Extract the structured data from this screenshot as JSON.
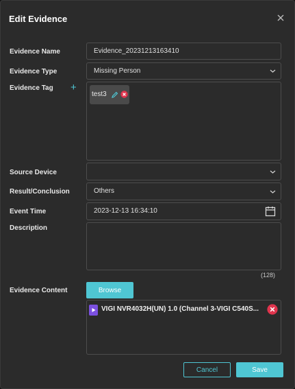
{
  "dialog": {
    "title": "Edit Evidence"
  },
  "fields": {
    "name": {
      "label": "Evidence Name",
      "value": "Evidence_20231213163410"
    },
    "type": {
      "label": "Evidence Type",
      "value": "Missing Person"
    },
    "tag": {
      "label": "Evidence Tag",
      "add_symbol": "+",
      "tags": [
        "test3"
      ]
    },
    "source": {
      "label": "Source Device",
      "value": ""
    },
    "result": {
      "label": "Result/Conclusion",
      "value": "Others"
    },
    "time": {
      "label": "Event Time",
      "value": "2023-12-13 16:34:10"
    },
    "description": {
      "label": "Description",
      "value": "",
      "counter": "(128)"
    },
    "content": {
      "label": "Evidence Content",
      "browse_label": "Browse",
      "files": [
        "VIGI NVR4032H(UN) 1.0 (Channel 3-VIGI C540S..."
      ]
    }
  },
  "footer": {
    "cancel_label": "Cancel",
    "save_label": "Save"
  },
  "colors": {
    "accent": "#4fc6d3",
    "delete": "#e0344d",
    "video_icon": "#7b50e0",
    "background": "#2b2b2b"
  },
  "icons": {
    "close": "close-icon",
    "dropdown": "chevron-down-icon",
    "calendar": "calendar-icon",
    "edit": "pencil-icon",
    "remove": "remove-icon",
    "video": "video-file-icon"
  }
}
